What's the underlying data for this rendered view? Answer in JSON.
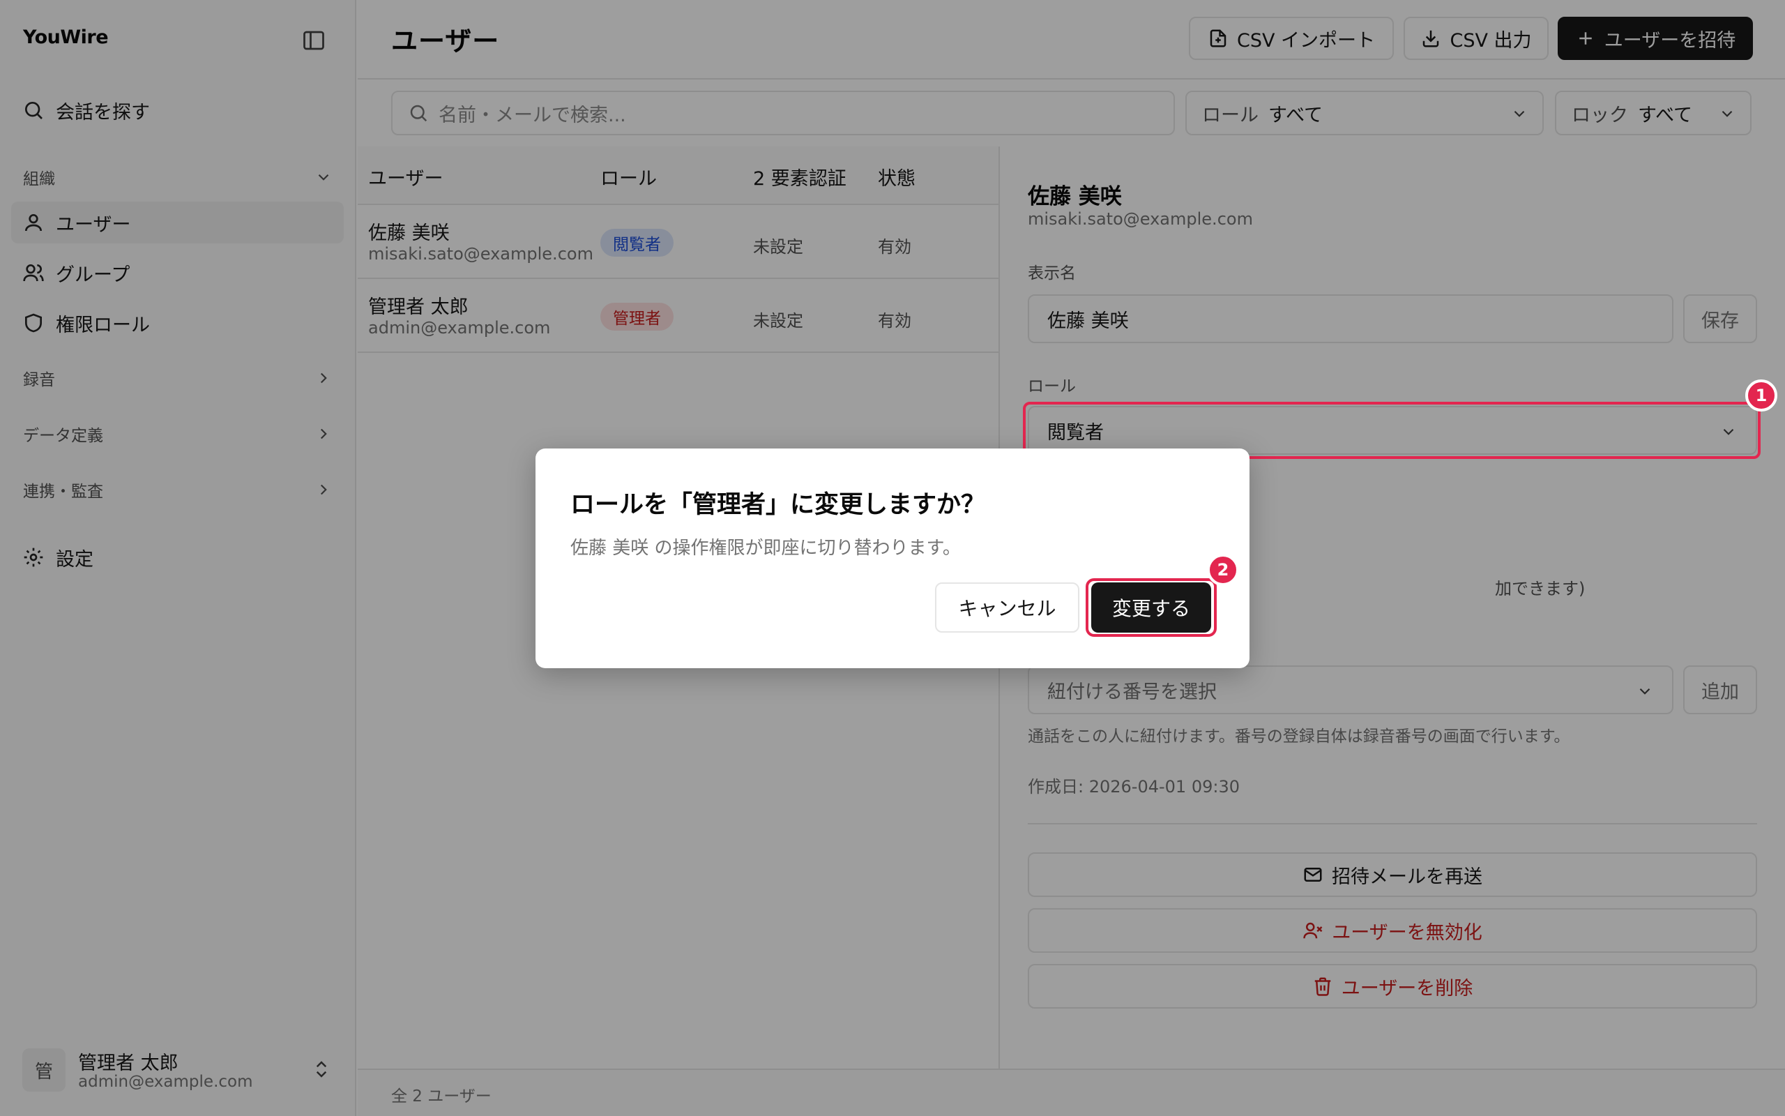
{
  "sidebar": {
    "brand": "YouWire",
    "search_label": "会話を探す",
    "org_group": "組織",
    "items": [
      {
        "label": "ユーザー"
      },
      {
        "label": "グループ"
      },
      {
        "label": "権限ロール"
      }
    ],
    "groups": [
      {
        "label": "録音"
      },
      {
        "label": "データ定義"
      },
      {
        "label": "連携・監査"
      }
    ],
    "settings_label": "設定",
    "user": {
      "avatar": "管",
      "name": "管理者 太郎",
      "email": "admin@example.com"
    }
  },
  "header": {
    "title": "ユーザー",
    "import_label": "CSV インポート",
    "export_label": "CSV 出力",
    "invite_label": "ユーザーを招待"
  },
  "filters": {
    "search_placeholder": "名前・メールで検索...",
    "role_label": "ロール",
    "role_value": "すべて",
    "lock_label": "ロック",
    "lock_value": "すべて"
  },
  "table": {
    "columns": [
      "ユーザー",
      "ロール",
      "2 要素認証",
      "状態"
    ],
    "rows": [
      {
        "name": "佐藤 美咲",
        "email": "misaki.sato@example.com",
        "role": "閲覧者",
        "mfa": "未設定",
        "status": "有効"
      },
      {
        "name": "管理者 太郎",
        "email": "admin@example.com",
        "role": "管理者",
        "mfa": "未設定",
        "status": "有効"
      }
    ]
  },
  "detail": {
    "name": "佐藤 美咲",
    "email": "misaki.sato@example.com",
    "display_name_label": "表示名",
    "display_name_value": "佐藤 美咲",
    "save_label": "保存",
    "role_label": "ロール",
    "role_value": "閲覧者",
    "partial_text": "加できます)",
    "number_placeholder": "紐付ける番号を選択",
    "add_label": "追加",
    "number_help": "通話をこの人に紐付けます。番号の登録自体は録音番号の画面で行います。",
    "created": "作成日: 2026-04-01 09:30",
    "resend_label": "招待メールを再送",
    "disable_label": "ユーザーを無効化",
    "delete_label": "ユーザーを削除"
  },
  "footer": {
    "count": "全 2 ユーザー"
  },
  "dialog": {
    "title": "ロールを「管理者」に変更しますか？",
    "description": "佐藤 美咲 の操作権限が即座に切り替わります。",
    "cancel_label": "キャンセル",
    "confirm_label": "変更する"
  },
  "markers": {
    "first": "1",
    "second": "2"
  },
  "colors": {
    "accent": "#e3264f",
    "primary": "#171717",
    "viewer_badge": "#1d4ed8",
    "admin_badge": "#c81e1e"
  }
}
